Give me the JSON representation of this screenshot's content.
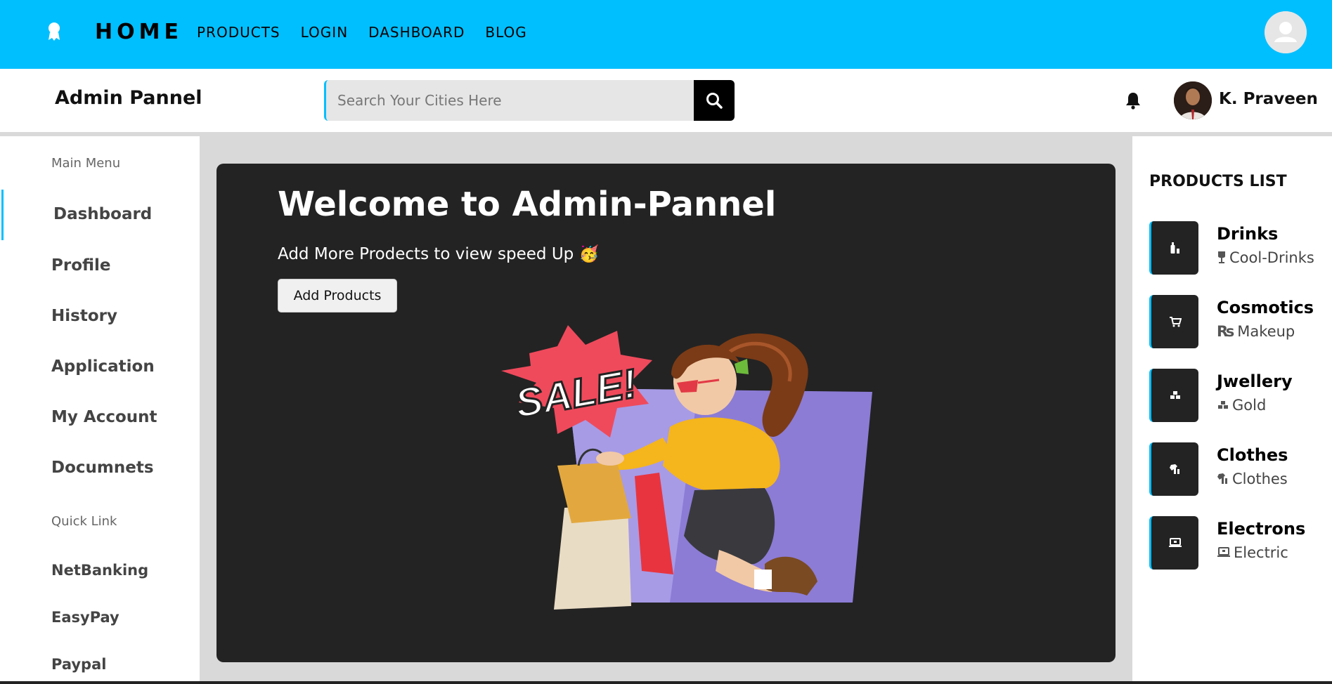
{
  "topnav": {
    "logo_icon": "award-icon",
    "home_label": "HOME",
    "links": [
      "PRODUCTS",
      "LOGIN",
      "DASHBOARD",
      "BLOG"
    ],
    "avatar_icon": "user-avatar-icon"
  },
  "subbar": {
    "title": "Admin Pannel",
    "search_placeholder": "Search Your Cities Here",
    "search_icon": "search-icon",
    "bell_icon": "bell-icon",
    "user_name": "K. Praveen"
  },
  "sidebar": {
    "main_menu_label": "Main Menu",
    "main_items": [
      "Dashboard",
      "Profile",
      "History",
      "Application",
      "My Account",
      "Documnets"
    ],
    "active_item": "Dashboard",
    "quick_link_label": "Quick Link",
    "quick_items": [
      "NetBanking",
      "EasyPay",
      "Paypal"
    ]
  },
  "main": {
    "welcome": "Welcome to Admin-Pannel",
    "subtitle": "Add More Prodects to view speed Up 🥳",
    "add_button": "Add Products",
    "illustration_text": "SALE!"
  },
  "products": {
    "title": "PRODUCTS LIST",
    "items": [
      {
        "name": "Drinks",
        "category": "Cool-Drinks",
        "icon": "bottle-icon",
        "cat_icon": "wine-glass-icon"
      },
      {
        "name": "Cosmotics",
        "category": "Makeup",
        "icon": "cart-icon",
        "cat_icon": "rupee-icon",
        "cat_prefix": "₨"
      },
      {
        "name": "Jwellery",
        "category": "Gold",
        "icon": "gold-bars-icon",
        "cat_icon": "gold-bars-icon"
      },
      {
        "name": "Clothes",
        "category": "Clothes",
        "icon": "shirt-icon",
        "cat_icon": "shirt-icon"
      },
      {
        "name": "Electrons",
        "category": "Electric",
        "icon": "laptop-icon",
        "cat_icon": "laptop-icon"
      }
    ]
  },
  "colors": {
    "accent": "#00bfff",
    "dark_card": "#232323",
    "page_bg": "#d9d9d9"
  }
}
